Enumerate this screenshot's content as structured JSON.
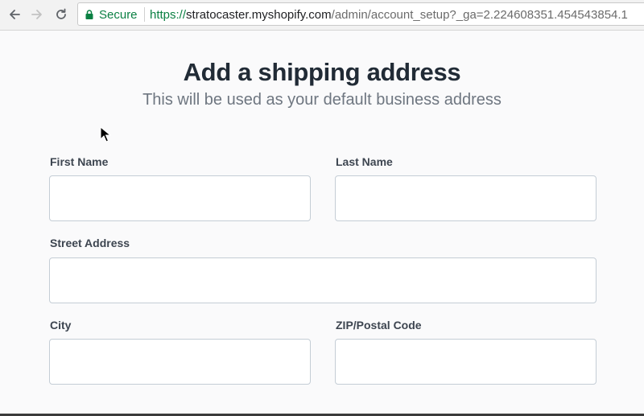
{
  "browser": {
    "secure_label": "Secure",
    "url_scheme": "https://",
    "url_host": "stratocaster.myshopify.com",
    "url_path": "/admin/account_setup?_ga=2.224608351.454543854.1",
    "icons": [
      "back-arrow-icon",
      "forward-arrow-icon",
      "reload-icon",
      "lock-icon"
    ]
  },
  "page": {
    "title": "Add a shipping address",
    "subtitle": "This will be used as your default business address"
  },
  "form": {
    "first_name": {
      "label": "First Name",
      "value": "",
      "placeholder": ""
    },
    "last_name": {
      "label": "Last Name",
      "value": "",
      "placeholder": ""
    },
    "street_address": {
      "label": "Street Address",
      "value": "",
      "placeholder": ""
    },
    "city": {
      "label": "City",
      "value": "",
      "placeholder": ""
    },
    "zip": {
      "label": "ZIP/Postal Code",
      "value": "",
      "placeholder": ""
    }
  },
  "colors": {
    "secure_green": "#0b8043",
    "title_text": "#212b36",
    "subtitle_text": "#6e7680",
    "input_border": "#c4cdd5"
  }
}
